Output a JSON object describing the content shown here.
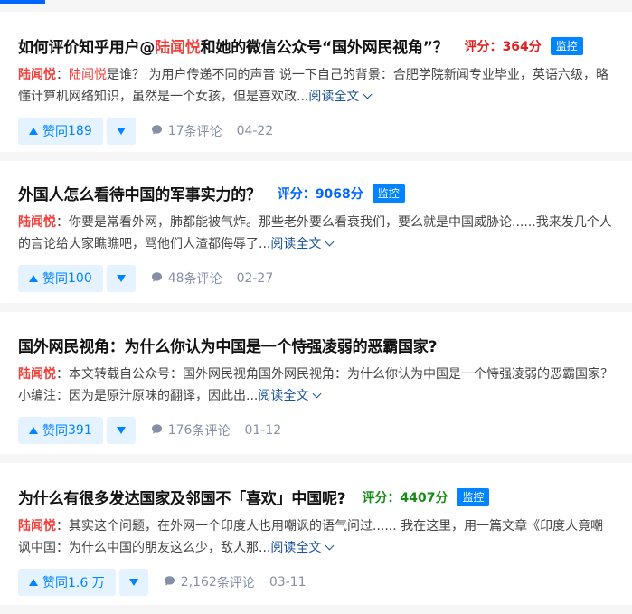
{
  "colors": {
    "accent": "#0084ff",
    "highlight": "#f1403c",
    "read_more": "#175199",
    "meta": "#8590a6"
  },
  "labels": {
    "score_prefix": "评分：",
    "score_suffix": "分",
    "monitor": "监控",
    "read_more": "阅读全文",
    "vote_up_prefix": "赞同 ",
    "comment_suffix": " 条评论",
    "author_colon": "："
  },
  "cards": [
    {
      "title_segments": [
        {
          "text": "如何评价知乎用户@",
          "hl": false
        },
        {
          "text": "陆闻悦",
          "hl": true
        },
        {
          "text": "和她的微信公众号“国外网民视角”？",
          "hl": false
        }
      ],
      "score": "364",
      "score_color": "#e01e1e",
      "author": "陆闻悦",
      "excerpt_segments": [
        {
          "text": "陆闻悦",
          "hl": true
        },
        {
          "text": "是谁？ 为用户传递不同的声音 说一下自己的背景：合肥学院新闻专业毕业，英语六级，略懂计算机网络知识，虽然是一个女孩，但是喜欢政...",
          "hl": false
        }
      ],
      "votes": "189",
      "comments": "17",
      "date": "04-22"
    },
    {
      "title_segments": [
        {
          "text": "外国人怎么看待中国的军事实力的？",
          "hl": false
        }
      ],
      "score": "9068",
      "score_color": "#0066ff",
      "author": "陆闻悦",
      "excerpt_segments": [
        {
          "text": "你要是常看外网，肺都能被气炸。那些老外要么看衰我们，要么就是中国威胁论......我来发几个人的言论给大家瞧瞧吧，骂他们人渣都侮辱了...",
          "hl": false
        }
      ],
      "votes": "100",
      "comments": "48",
      "date": "02-27"
    },
    {
      "title_segments": [
        {
          "text": "国外网民视角：为什么你认为中国是一个恃强凌弱的恶霸国家?",
          "hl": false
        }
      ],
      "score": "",
      "score_color": "#0066ff",
      "author": "陆闻悦",
      "excerpt_segments": [
        {
          "text": "本文转载自公众号：国外网民视角国外网民视角：为什么你认为中国是一个恃强凌弱的恶霸国家？ 小编注：因为是原汁原味的翻译，因此出...",
          "hl": false
        }
      ],
      "votes": "391",
      "comments": "176",
      "date": "01-12"
    },
    {
      "title_segments": [
        {
          "text": "为什么有很多发达国家及邻国不「喜欢」中国呢?",
          "hl": false
        }
      ],
      "score": "4407",
      "score_color": "#138d13",
      "author": "陆闻悦",
      "excerpt_segments": [
        {
          "text": "其实这个问题，在外网一个印度人也用嘲讽的语气问过...... 我在这里，用一篇文章《印度人竟嘲讽中国：为什么中国的朋友这么少，敌人那...",
          "hl": false
        }
      ],
      "votes": "1.6 万",
      "comments": "2,162",
      "date": "03-11"
    }
  ]
}
